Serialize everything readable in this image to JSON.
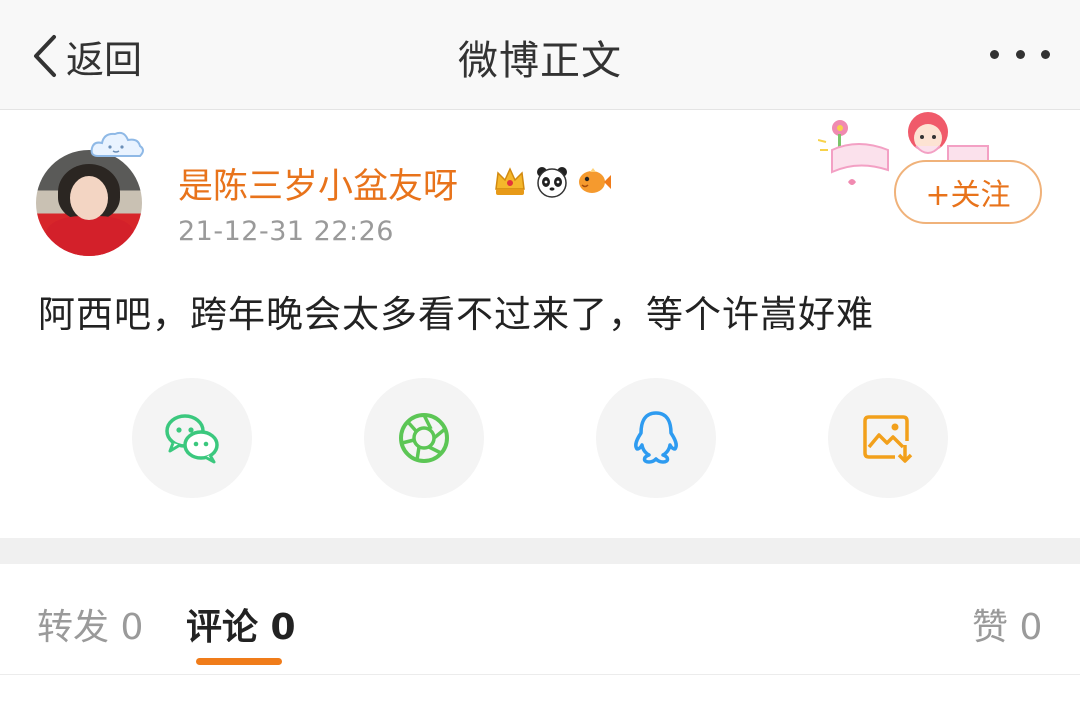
{
  "header": {
    "back_label": "返回",
    "title": "微博正文"
  },
  "post": {
    "username": "是陈三岁小盆友呀",
    "timestamp": "21-12-31 22:26",
    "content": "阿西吧，跨年晚会太多看不过来了，等个许嵩好难",
    "follow_label": "+关注",
    "badges": [
      "crown-badge-icon",
      "panda-badge-icon",
      "fish-badge-icon"
    ]
  },
  "share": {
    "icons": [
      "wechat-icon",
      "moments-icon",
      "qq-icon",
      "save-image-icon"
    ]
  },
  "tabs": {
    "repost": "转发 0",
    "comment": "评论 0",
    "like": "赞 0"
  },
  "colors": {
    "accent": "#e8731b",
    "tab_underline": "#f07c1a",
    "wechat": "#3bc87e",
    "moments": "#5cc655",
    "qq": "#2e9bf0",
    "save": "#f2a01b"
  }
}
